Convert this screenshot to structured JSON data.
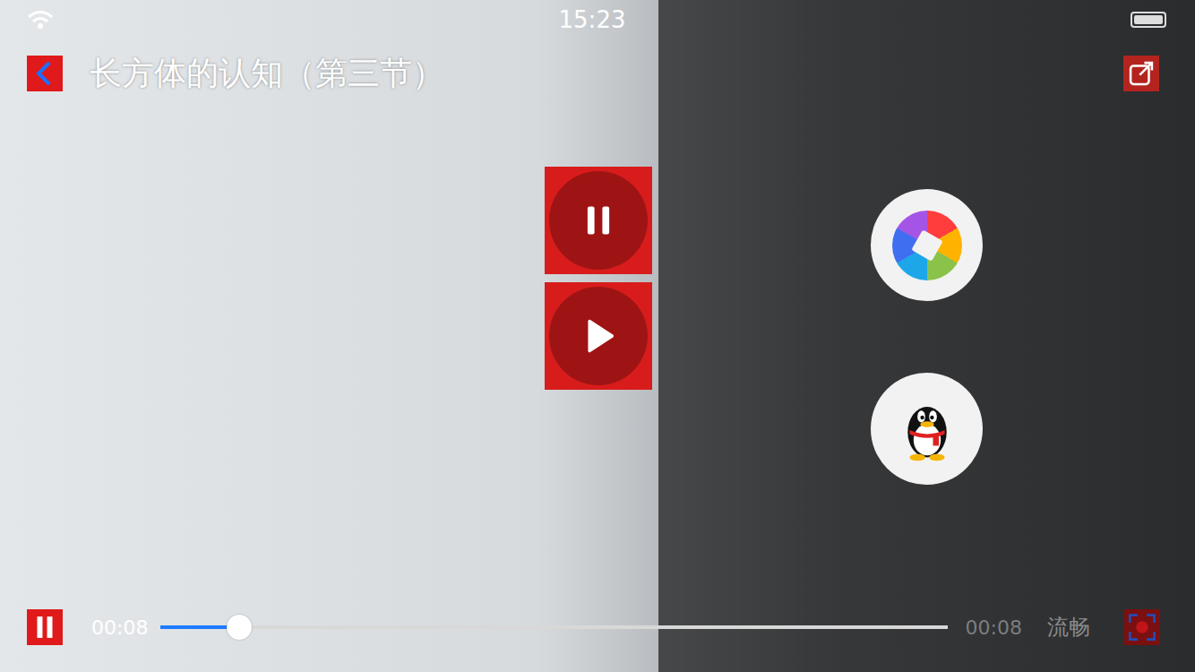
{
  "status_bar": {
    "time": "15:23"
  },
  "header": {
    "title": "长方体的认知（第三节）"
  },
  "center_controls": [
    {
      "kind": "pause"
    },
    {
      "kind": "play"
    }
  ],
  "share_targets": [
    {
      "kind": "album"
    },
    {
      "kind": "qq"
    }
  ],
  "player": {
    "playing": true,
    "elapsed": "00:08",
    "duration": "00:08",
    "level": 0.1,
    "quality": "流畅"
  }
}
